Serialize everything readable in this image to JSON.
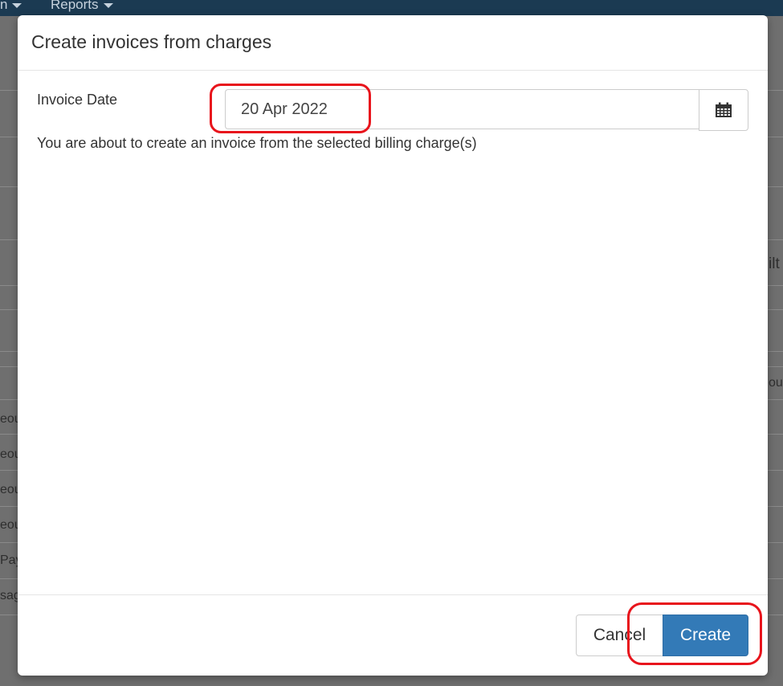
{
  "background": {
    "nav_items": [
      "n",
      "Reports"
    ],
    "fragments": [
      "ilt",
      "ou",
      "eou",
      "eou",
      "eou",
      "eou",
      "Pay",
      "sag"
    ]
  },
  "dialog": {
    "title": "Create invoices from charges",
    "invoice_date_label": "Invoice Date",
    "invoice_date_value": "20 Apr 2022",
    "calendar_icon": "calendar-icon",
    "info_text": "You are about to create an invoice from the selected billing charge(s)",
    "cancel_label": "Cancel",
    "create_label": "Create"
  },
  "colors": {
    "primary": "#337ab7",
    "annotation": "#e8141c",
    "nav_bg": "#1b3a52"
  }
}
